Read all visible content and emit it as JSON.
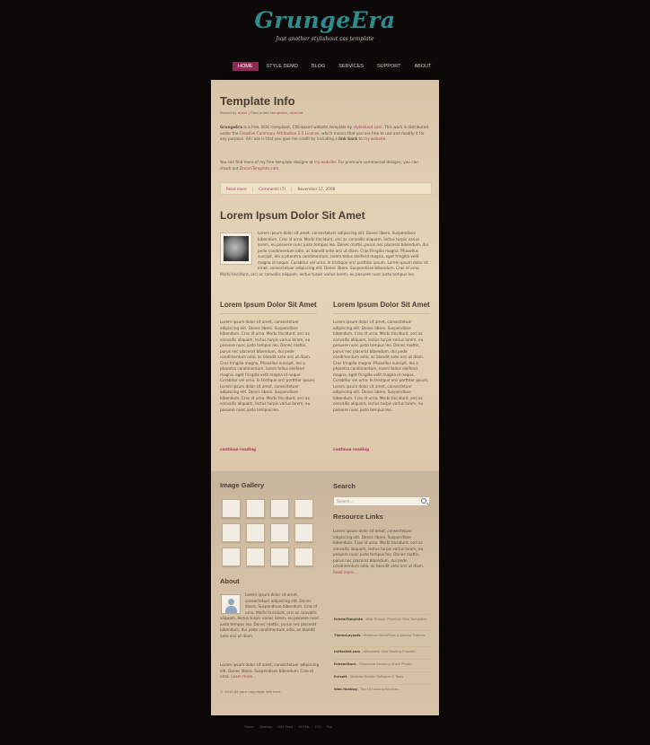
{
  "site": {
    "logo": "GrungeEra",
    "tagline": "Just another stylishout css template"
  },
  "nav": [
    {
      "label": "Home",
      "active": true
    },
    {
      "label": "Style Demo",
      "active": false
    },
    {
      "label": "Blog",
      "active": false
    },
    {
      "label": "Services",
      "active": false
    },
    {
      "label": "Support",
      "active": false
    },
    {
      "label": "About",
      "active": false
    }
  ],
  "post1": {
    "title": "Template Info",
    "meta_prefix": "Posted by ",
    "meta_author": "erwin",
    "meta_mid": " | Filed under ",
    "meta_cat1": "templates",
    "meta_sep": ", ",
    "meta_cat2": "internet",
    "body1_strong": "GrungeEra",
    "body1_a": " is a free, W3C-compliant, CSS-based website template by ",
    "body1_link1": "styleshout.com",
    "body1_b": ". This work is distributed under the ",
    "body1_link2": "Creative Commons Attribution 2.5 License",
    "body1_c": ", which means that you are free to use and modify it for any purpose. All I ask is that you give me credit by including a ",
    "body1_strong2": "link back",
    "body1_d": " to ",
    "body1_link3": "my website",
    "body1_e": ".",
    "body2_a": "You can find more of my free template designs at ",
    "body2_link1": "my website",
    "body2_b": ". For premium commercial designs, you can check out ",
    "body2_link2": "DreamTemplate.com",
    "body2_c": ".",
    "read_more": "Read more",
    "sep": "|",
    "comments": "Comments (7)",
    "date": "November 17, 2008"
  },
  "post2": {
    "title": "Lorem Ipsum Dolor Sit Amet",
    "body": "Lorem ipsum dolor sit amet, consectetuer adipiscing elit. Donec libero. Suspendisse bibendum. Cras id urna. Morbi tincidunt, orci ac convallis aliquam, lectus turpis varius lorem, eu posuere nunc justo tempus leo. Donec mattis, purus nec placerat bibendum, dui pede condimentum odio, ac blandit ante orci ut diam. Cras fringilla magna. Phasellus suscipit, leo a pharetra condimentum, lorem tellus eleifend magna, eget fringilla velit magna id neque. Curabitur vel urna. In tristique orci porttitor ipsum. Lorem ipsum dolor sit amet, consectetuer adipiscing elit. Donec libero. Suspendisse bibendum. Cras id urna. Morbi tincidunt, orci ac convallis aliquam, lectus turpis varius lorem, eu posuere nunc justo tempus leo."
  },
  "columns": [
    {
      "title": "Lorem Ipsum Dolor Sit Amet",
      "body": "Lorem ipsum dolor sit amet, consectetuer adipiscing elit. Donec libero. Suspendisse bibendum. Cras id urna. Morbi tincidunt, orci ac convallis aliquam, lectus turpis varius lorem, eu posuere nunc justo tempus leo. Donec mattis, purus nec placerat bibendum, dui pede condimentum odio, ac blandit ante orci ut diam. Cras fringilla magna. Phasellus suscipit, leo a pharetra condimentum, lorem tellus eleifend magna, eget fringilla velit magna id neque. Curabitur vel urna. In tristique orci porttitor ipsum. Lorem ipsum dolor sit amet, consectetuer adipiscing elit. Donec libero. Suspendisse bibendum. Cras id urna. Morbi tincidunt, orci ac convallis aliquam, lectus turpis varius lorem, eu posuere nunc justo tempus leo.",
      "cont": "continue reading"
    },
    {
      "title": "Lorem Ipsum Dolor Sit Amet",
      "body": "Lorem ipsum dolor sit amet, consectetuer adipiscing elit. Donec libero. Suspendisse bibendum. Cras id urna. Morbi tincidunt, orci ac convallis aliquam, lectus turpis varius lorem, eu posuere nunc justo tempus leo. Donec mattis, purus nec placerat bibendum, dui pede condimentum odio, ac blandit ante orci ut diam. Cras fringilla magna. Phasellus suscipit, leo a pharetra condimentum, lorem tellus eleifend magna, eget fringilla velit magna id neque. Curabitur vel urna. In tristique orci porttitor ipsum. Lorem ipsum dolor sit amet, consectetuer adipiscing elit. Donec libero. Suspendisse bibendum. Cras id urna. Morbi tincidunt, orci ac convallis aliquam, lectus turpis varius lorem, eu posuere nunc justo tempus leo.",
      "cont": "continue reading"
    }
  ],
  "sidebar": {
    "gallery_title": "Image Gallery",
    "about_title": "About",
    "about_body1": "Lorem ipsum dolor sit amet, consectetuer adipiscing elit. Donec libero. Suspendisse bibendum. Cras id urna. Morbi tincidunt, orci ac convallis aliquam, lectus turpis varius lorem, eu posuere nunc justo tempus leo. Donec mattis, purus nec placerat bibendum, dui pede condimentum odio, ac blandit ante orci ut diam.",
    "about_body2": "Lorem ipsum dolor sit amet, consectetuer adipiscing elit. Donec libero. Suspendisse bibendum. Cras id urna.",
    "learn_more": "Learn more...",
    "copyright": "© 2010 All your copyright info here",
    "search_title": "Search",
    "search_placeholder": "Search...",
    "resources_title": "Resource Links",
    "resources_body": "Lorem ipsum dolor sit amet, consectetuer adipiscing elit. Donec libero. Suspendisse bibendum. Cras id urna. Morbi tincidunt, orci ac convallis aliquam, lectus turpis varius lorem, eu posuere nunc justo tempus leo. Donec mattis, purus nec placerat bibendum, dui pede condimentum odio, ac blandit ante orci ut diam.",
    "read_more": "Read more...",
    "links": [
      {
        "name": "DreamTemplate",
        "desc": " - Web Design, Premium Web Templates"
      },
      {
        "name": "ThemeLayouts",
        "desc": " - Premium WordPress & Joomla Themes"
      },
      {
        "name": "ImHosted.com",
        "desc": " - Affordable Web Hosting Provider"
      },
      {
        "name": "DreamStock",
        "desc": " - Download Amazing Stock Photos"
      },
      {
        "name": "Evrsoft",
        "desc": " - Website Builder Software & Tools"
      },
      {
        "name": "Web Hosting",
        "desc": " - Top 10 Hosting Reviews"
      }
    ]
  },
  "footer_links": [
    "Home",
    "Sitemap",
    "RSS Feed",
    "XHTML",
    "CSS",
    "Top"
  ]
}
